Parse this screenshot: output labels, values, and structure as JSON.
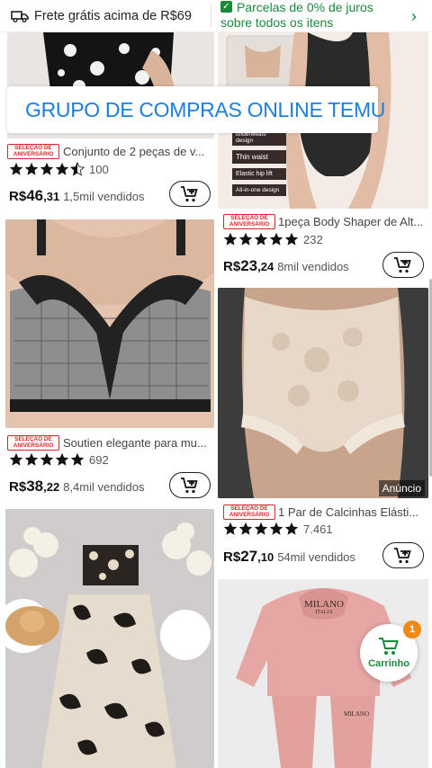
{
  "topbar": {
    "free_shipping": "Frete grátis acima de R$69",
    "installments_line1": "Parcelas de 0% de juros",
    "installments_line2": "sobre todos os itens"
  },
  "banner": {
    "text": "GRUPO DE COMPRAS ONLINE TEMU"
  },
  "badge": {
    "line1": "SELEÇÃO DE",
    "line2": "ANIVERSÁRIO"
  },
  "products": [
    {
      "title": "Conjunto de 2 peças de v...",
      "rating": 4.5,
      "reviews": "100",
      "currency": "R$",
      "price_int": "46",
      "price_dec": ",31",
      "sold": "1,5mil vendidos"
    },
    {
      "title": "1peça Body Shaper de Alt...",
      "rating": 5,
      "reviews": "232",
      "currency": "R$",
      "price_int": "23",
      "price_dec": ",24",
      "sold": "8mil vendidos",
      "labels": [
        "underweats design",
        "Thin waist",
        "Elastic hip lift",
        "All-in-one design"
      ]
    },
    {
      "title": "Soutien elegante para mu...",
      "rating": 5,
      "reviews": "692",
      "currency": "R$",
      "price_int": "38",
      "price_dec": ",22",
      "sold": "8,4mil vendidos"
    },
    {
      "title": "1 Par de Calcinhas Elásti...",
      "rating": 5,
      "reviews": "7.461",
      "currency": "R$",
      "price_int": "27",
      "price_dec": ",10",
      "sold": "54mil vendidos",
      "ad_label": "Anúncio"
    },
    {
      "sweatshirt_text": "MILANO",
      "sweatshirt_sub": "ITALIA"
    }
  ],
  "cart_fab": {
    "label": "Carrinho",
    "count": "1"
  },
  "colors": {
    "accent_green": "#1a8a3a",
    "link_blue": "#1c7fe0",
    "badge_red": "#e0232a",
    "count_orange": "#f08a14"
  }
}
